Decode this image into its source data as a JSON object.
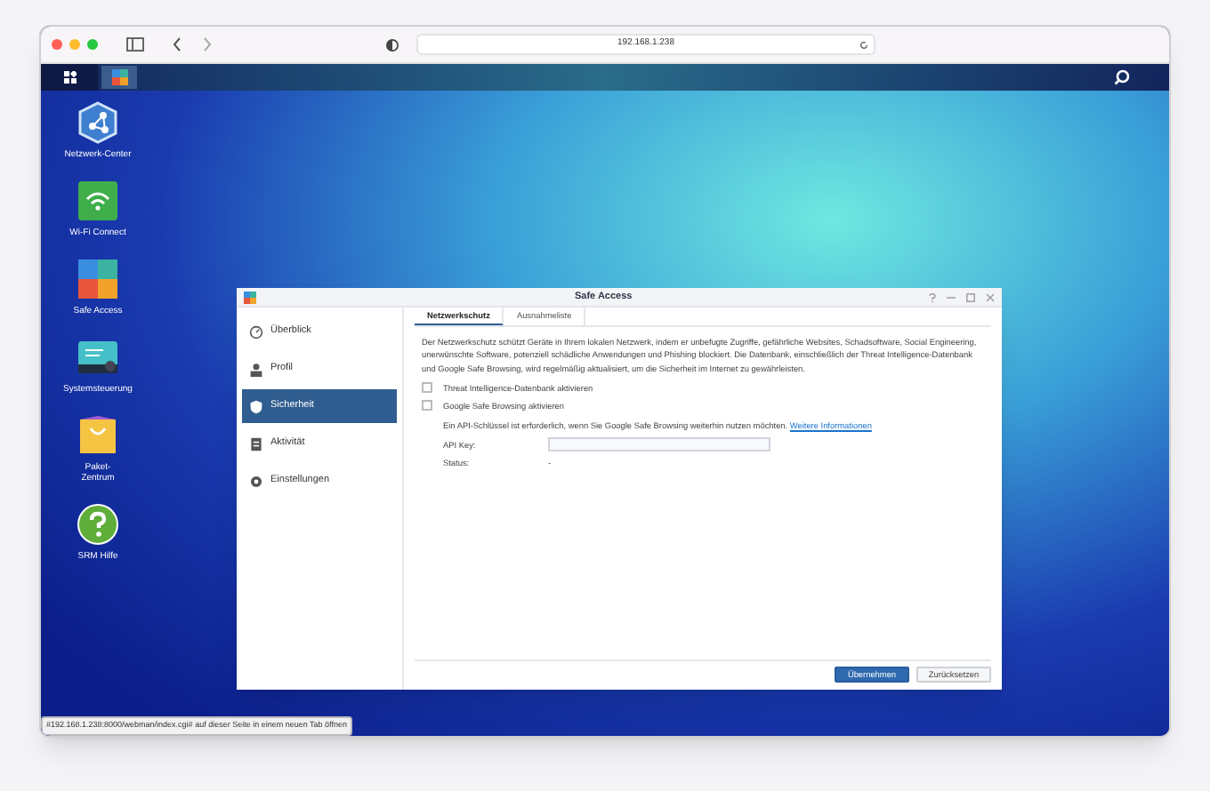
{
  "browser": {
    "address": "192.168.1.238",
    "status_link": "#192.168.1.238:8000/webman/index.cgi# auf dieser Seite in einem neuen Tab öffnen"
  },
  "desktop_icons": [
    {
      "kind": "network",
      "label": "Netzwerk-Center"
    },
    {
      "kind": "wifi",
      "label": "Wi-Fi Connect"
    },
    {
      "kind": "safe",
      "label": "Safe Access"
    },
    {
      "kind": "control",
      "label": "Systemsteuerung"
    },
    {
      "kind": "package",
      "label": "Paket-\nZentrum"
    },
    {
      "kind": "help",
      "label": "SRM Hilfe"
    }
  ],
  "window": {
    "title": "Safe Access",
    "sidebar": {
      "items": [
        {
          "kind": "overview",
          "label": "Überblick",
          "selected": false
        },
        {
          "kind": "profile",
          "label": "Profil",
          "selected": false
        },
        {
          "kind": "security",
          "label": "Sicherheit",
          "selected": true
        },
        {
          "kind": "activity",
          "label": "Aktivität",
          "selected": false
        },
        {
          "kind": "settings",
          "label": "Einstellungen",
          "selected": false
        }
      ]
    },
    "tabs": [
      {
        "label": "Netzwerkschutz",
        "selected": true
      },
      {
        "label": "Ausnahmeliste",
        "selected": false
      }
    ],
    "description": "Der Netzwerkschutz schützt Geräte in Ihrem lokalen Netzwerk, indem er unbefugte Zugriffe, gefährliche Websites, Schadsoftware, Social Engineering, unerwünschte Software, potenziell schädliche Anwendungen und Phishing blockiert. Die Datenbank, einschließlich der Threat Intelligence-Datenbank und Google Safe Browsing, wird regelmäßig aktualisiert, um die Sicherheit im Internet zu gewährleisten.",
    "options": [
      {
        "label": "Threat Intelligence-Datenbank aktivieren",
        "checked": false
      },
      {
        "label": "Google Safe Browsing aktivieren",
        "checked": false
      }
    ],
    "api_note": "Ein API-Schlüssel ist erforderlich, wenn Sie Google Safe Browsing weiterhin nutzen möchten.",
    "api_link": "Weitere Informationen",
    "api_key_label": "API Key:",
    "status_label": "Status:",
    "status_value": "-",
    "buttons": [
      {
        "label": "Übernehmen",
        "kind": "primary"
      },
      {
        "label": "Zurücksetzen",
        "kind": "secondary"
      }
    ]
  }
}
